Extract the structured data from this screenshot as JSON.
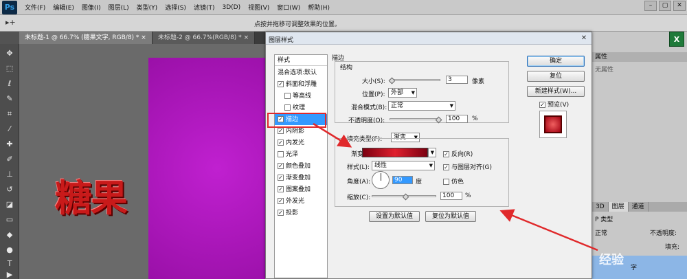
{
  "app": {
    "logo": "Ps",
    "menu": [
      "文件(F)",
      "编辑(E)",
      "图像(I)",
      "图层(L)",
      "类型(Y)",
      "选择(S)",
      "滤镜(T)",
      "3D(D)",
      "视图(V)",
      "窗口(W)",
      "帮助(H)"
    ],
    "window_controls": [
      "–",
      "▢",
      "✕"
    ]
  },
  "options_bar": {
    "tool_icon": "▸+",
    "hint": "点按并拖移可调整效果的位置。"
  },
  "tabs": [
    {
      "label": "未标题-1 @ 66.7% (糖果文字, RGB/8) *",
      "close": "×"
    },
    {
      "label": "未标题-2 @ 66.7%(RGB/8) *",
      "close": "×"
    }
  ],
  "canvas": {
    "text": "糖果"
  },
  "right_panel": {
    "props_tab": "属性",
    "props_label": "无属性",
    "excel_label": "X",
    "layers_tabs": [
      "3D",
      "图层",
      "通道"
    ],
    "kind": "P 类型",
    "mode": "正常",
    "opacity_label": "不透明度:",
    "fill_label": "填充:",
    "layer_name": "字",
    "watermark": "经验"
  },
  "dialog": {
    "title": "图层样式",
    "close": "✕",
    "styles_header": "样式",
    "styles": [
      {
        "label": "混合选项:默认",
        "checkbox": false,
        "checked": false,
        "sub": false
      },
      {
        "label": "斜面和浮雕",
        "checkbox": true,
        "checked": true,
        "sub": false
      },
      {
        "label": "等高线",
        "checkbox": true,
        "checked": false,
        "sub": true
      },
      {
        "label": "纹理",
        "checkbox": true,
        "checked": false,
        "sub": true
      },
      {
        "label": "描边",
        "checkbox": true,
        "checked": true,
        "sub": false,
        "selected": true
      },
      {
        "label": "内阴影",
        "checkbox": true,
        "checked": true,
        "sub": false
      },
      {
        "label": "内发光",
        "checkbox": true,
        "checked": true,
        "sub": false
      },
      {
        "label": "光泽",
        "checkbox": true,
        "checked": false,
        "sub": false
      },
      {
        "label": "颜色叠加",
        "checkbox": true,
        "checked": true,
        "sub": false
      },
      {
        "label": "渐变叠加",
        "checkbox": true,
        "checked": true,
        "sub": false
      },
      {
        "label": "图案叠加",
        "checkbox": true,
        "checked": true,
        "sub": false
      },
      {
        "label": "外发光",
        "checkbox": true,
        "checked": true,
        "sub": false
      },
      {
        "label": "投影",
        "checkbox": true,
        "checked": true,
        "sub": false
      }
    ],
    "stroke": {
      "title": "描边",
      "structure": "结构",
      "size_label": "大小(S):",
      "size_value": "3",
      "size_unit": "像素",
      "position_label": "位置(P):",
      "position_value": "外部",
      "blend_label": "混合模式(B):",
      "blend_value": "正常",
      "opacity_label": "不透明度(O):",
      "opacity_value": "100",
      "opacity_unit": "%",
      "fill_type_label": "填充类型(F):",
      "fill_type_value": "渐变",
      "gradient_label": "渐变:",
      "reverse_label": "反向(R)",
      "style_label": "样式(L):",
      "style_value": "线性",
      "align_label": "与图层对齐(G)",
      "angle_label": "角度(A):",
      "angle_value": "90",
      "angle_unit": "度",
      "dither_label": "仿色",
      "scale_label": "缩放(C):",
      "scale_value": "100",
      "scale_unit": "%",
      "make_default": "设置为默认值",
      "reset_default": "复位为默认值",
      "reverse_checked": true,
      "align_checked": true,
      "dither_checked": false
    },
    "buttons": {
      "ok": "确定",
      "reset": "复位",
      "new_style": "新建样式(W)...",
      "preview": "预览(V)",
      "preview_checked": true
    }
  },
  "colors": {
    "selection": "#3399ff",
    "highlight": "#e0292b",
    "canvas_bg": "#b418c8"
  }
}
